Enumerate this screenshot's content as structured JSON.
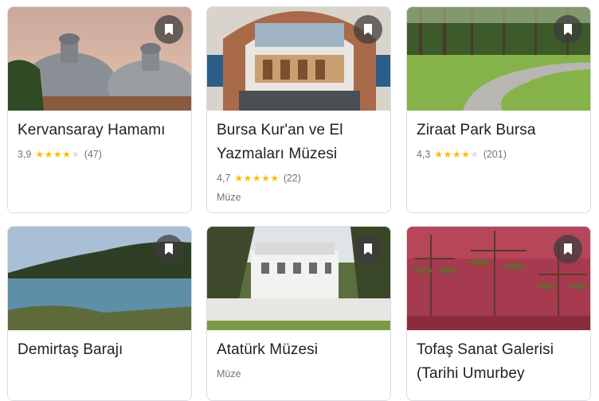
{
  "cards": [
    {
      "title": "Kervansaray Hamamı",
      "rating": "3,9",
      "reviews": "(47)",
      "stars": 4,
      "category": ""
    },
    {
      "title": "Bursa Kur'an ve El Yazmaları Müzesi",
      "rating": "4,7",
      "reviews": "(22)",
      "stars": 5,
      "category": "Müze"
    },
    {
      "title": "Ziraat Park Bursa",
      "rating": "4,3",
      "reviews": "(201)",
      "stars": 4.5,
      "category": ""
    },
    {
      "title": "Demirtaş Barajı",
      "rating": "",
      "reviews": "",
      "category": ""
    },
    {
      "title": "Atatürk Müzesi",
      "rating": "",
      "reviews": "",
      "category": "Müze"
    },
    {
      "title": "Tofaş Sanat Galerisi (Tarihi Umurbey",
      "rating": "",
      "reviews": "",
      "category": ""
    }
  ],
  "icons": {
    "save": "bookmark-icon",
    "star": "star-icon"
  },
  "colors": {
    "star": "#fbbc04",
    "border": "#dadce0",
    "muted": "#70757a"
  }
}
